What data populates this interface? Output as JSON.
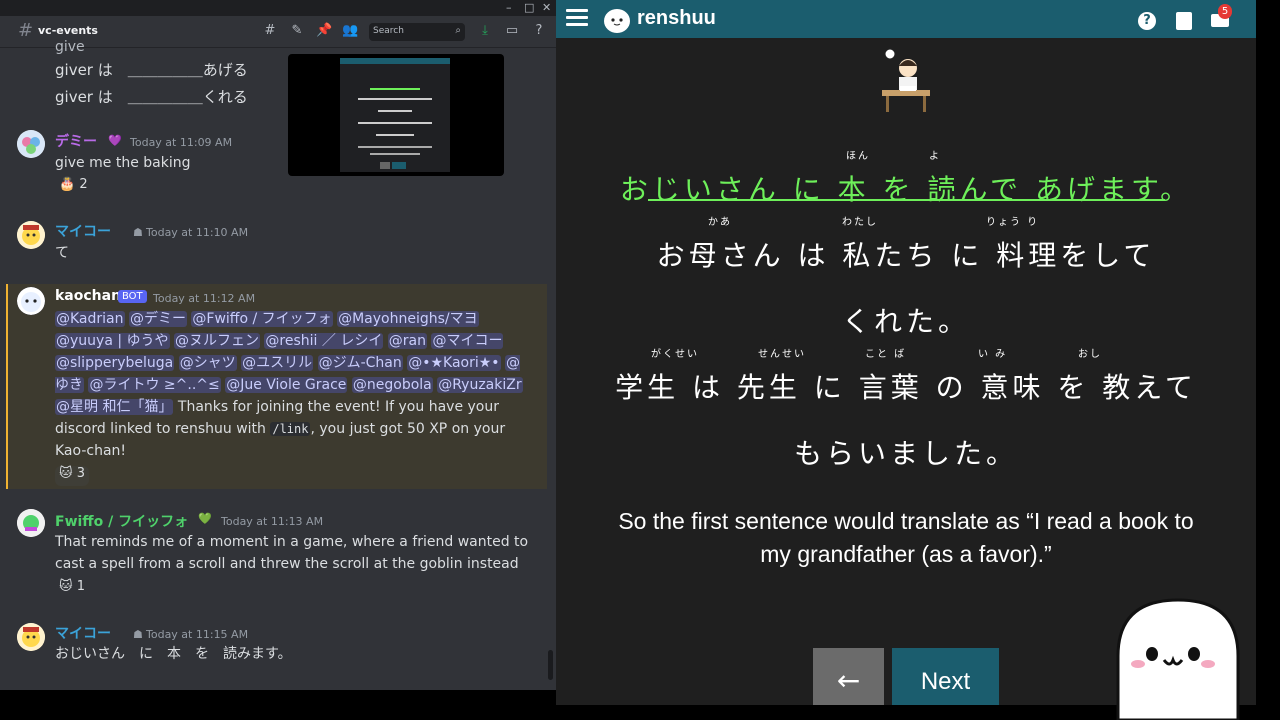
{
  "discord": {
    "channel": "vc-events",
    "search_placeholder": "Search",
    "window_controls": [
      "–",
      "□",
      "✕"
    ],
    "messages": [
      {
        "lines": [
          "give",
          "giver は　＿＿＿＿＿あげる",
          "giver は　＿＿＿＿＿くれる"
        ]
      },
      {
        "author": "デミー",
        "author_color": "#b96be8",
        "badge": "💜",
        "time": "Today at 11:09 AM",
        "text": "give me the baking",
        "reaction": "2"
      },
      {
        "author": "マイコー",
        "author_color": "#3ba3d9",
        "time": "Today at 11:10 AM",
        "text": "て"
      },
      {
        "author": "kaochan",
        "author_color": "#ffffff",
        "bot_label": "BOT",
        "time": "Today at 11:12 AM",
        "mentions": [
          "@Kadrian",
          "@デミー",
          "@Fwiffo / フイッフォ",
          "@Mayohneighs/マヨ",
          "@yuuya | ゆうや",
          "@ヌルフェン",
          "@reshii ／ レシイ",
          "@ran",
          "@マイコー",
          "@slipperybeluga",
          "@シャツ",
          "@ユスリル",
          "@ジム-Chan",
          "@•★Kaori★•",
          "@ゆき",
          "@ライトウ ≥^..^≤",
          "@Jue Viole Grace",
          "@negobola",
          "@RyuzakiZr",
          "@星明 和仁「猫」"
        ],
        "text_a": "Thanks for joining",
        "text_b": "the event! If you have your discord linked to renshuu with",
        "code": "/link",
        "text_c": ",",
        "text_d": "you just got 50 XP on your Kao-chan!",
        "reaction": "3"
      },
      {
        "author": "Fwiffo / フイッフォ",
        "author_color": "#4fd16b",
        "badge": "💚",
        "time": "Today at 11:13 AM",
        "text_lines": [
          "That reminds me of a moment in a game, where a friend wanted to",
          "cast a spell from a scroll and threw the scroll at the goblin instead"
        ],
        "reaction": "1"
      },
      {
        "author": "マイコー",
        "author_color": "#3ba3d9",
        "time": "Today at 11:15 AM",
        "text": "おじいさん　に　本　を　読みます。"
      }
    ]
  },
  "renshuu": {
    "brand": "renshuu",
    "help": "?",
    "mail_count": "5",
    "sentences": {
      "s1": "おじいさん に 本 を 読んで あげます。",
      "s1_furi": [
        "ほん",
        "よ"
      ],
      "s2a": "お母さん は 私たち に 料理をして",
      "s2b": "くれた。",
      "s2_furi": [
        "かあ",
        "わたし",
        "りょう り"
      ],
      "s3a": "学生 は 先生 に 言葉 の 意味 を 教えて",
      "s3b": "もらいました。",
      "s3_furi": [
        "がくせい",
        "せんせい",
        "こと ば",
        "い み",
        "おし"
      ]
    },
    "english": "So the first sentence would translate as “I read a book to my grandfather (as a favor).”",
    "back": "←",
    "next": "Next"
  }
}
